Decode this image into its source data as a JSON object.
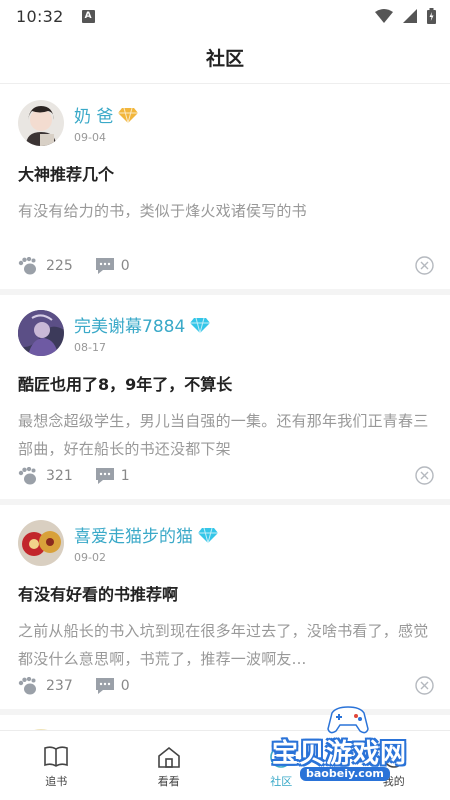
{
  "status": {
    "time": "10:32",
    "notification_letter": "A"
  },
  "header": {
    "title": "社区"
  },
  "posts": [
    {
      "username": "奶 爸",
      "date": "09-04",
      "title": "大神推荐几个",
      "body": "有没有给力的书，类似于烽火戏诸侯写的书",
      "likes": "225",
      "comments": "0",
      "vip_color": "#f2b63c"
    },
    {
      "username": "完美谢幕7884",
      "date": "08-17",
      "title": "酷匠也用了8，9年了，不算长",
      "body": "最想念超级学生，男儿当自强的一集。还有那年我们正青春三部曲，好在船长的书还没都下架",
      "likes": "321",
      "comments": "1",
      "vip_color": "#35c6e8"
    },
    {
      "username": "喜爱走猫步的猫",
      "date": "09-02",
      "title": "有没有好看的书推荐啊",
      "body": "之前从船长的书入坑到现在很多年过去了，没啥书看了，感觉都没什么意思啊，书荒了，推荐一波啊友...",
      "likes": "237",
      "comments": "0",
      "vip_color": "#35c6e8"
    }
  ],
  "tabs": [
    {
      "label": "追书",
      "icon": "book-icon"
    },
    {
      "label": "看看",
      "icon": "home-icon"
    },
    {
      "label": "社区",
      "icon": "community-icon"
    },
    {
      "label": "我的",
      "icon": "profile-icon"
    }
  ],
  "watermark": {
    "text": "宝贝游戏网",
    "url": "baobeiy.com"
  },
  "colors": {
    "accent": "#3aa9c8",
    "muted": "#999999",
    "watermark": "#2a73d8"
  }
}
